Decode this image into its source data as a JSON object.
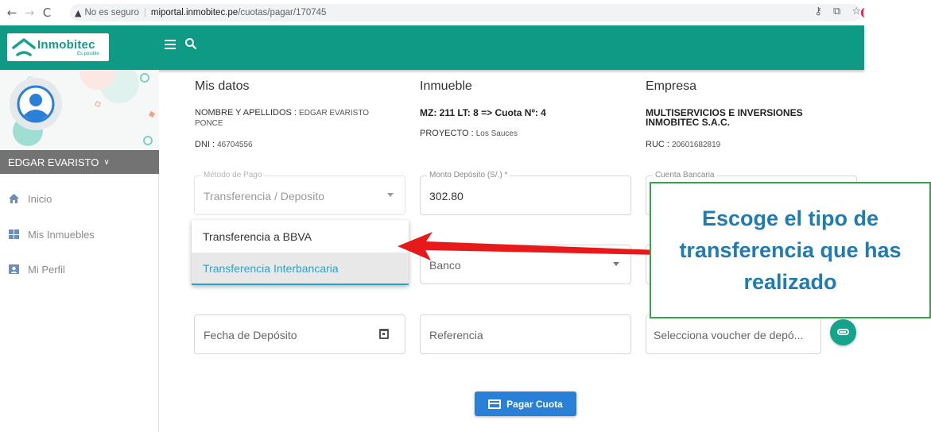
{
  "browser": {
    "security_text": "No es seguro",
    "url_host": "miportal.inmobitec.pe",
    "url_path": "/cuotas/pagar/170745"
  },
  "header": {
    "logo_name": "Inmobitec",
    "logo_tagline": "Es posible",
    "brand_color": "#0f9a85"
  },
  "sidebar": {
    "user_name": "EDGAR EVARISTO",
    "items": [
      {
        "label": "Inicio",
        "icon": "home-icon"
      },
      {
        "label": "Mis Inmuebles",
        "icon": "grid-icon"
      },
      {
        "label": "Mi Perfil",
        "icon": "profile-card-icon"
      }
    ]
  },
  "mis_datos": {
    "title": "Mis datos",
    "name_label": "NOMBRE Y APELLIDOS :",
    "name_value_1": "EDGAR EVARISTO",
    "name_value_2": "PONCE",
    "dni_label": "DNI :",
    "dni_value": "46704556"
  },
  "inmueble": {
    "title": "Inmueble",
    "lote": "MZ: 211 LT: 8 => Cuota Nº: 4",
    "proyecto_label": "PROYECTO :",
    "proyecto_value": "Los Sauces"
  },
  "empresa": {
    "title": "Empresa",
    "name_1": "MULTISERVICIOS E INVERSIONES",
    "name_2": "INMOBITEC S.A.C.",
    "ruc_label": "RUC :",
    "ruc_value": "20601682819"
  },
  "form": {
    "metodo_label": "Método de Pago",
    "metodo_value": "Transferencia / Deposito",
    "monto_label": "Monto Depósito (S/.) *",
    "monto_value": "302.80",
    "cuenta_label": "Cuenta Bancaria",
    "banco_placeholder": "Banco",
    "fecha_placeholder": "Fecha de Depósito",
    "referencia_placeholder": "Referencia",
    "voucher_placeholder": "Selecciona voucher de depó...",
    "dropdown_options": [
      "Transferencia a BBVA",
      "Transferencia Interbancaria"
    ],
    "selected_option": "Transferencia Interbancaria",
    "pay_button": "Pagar Cuota"
  },
  "annotation": {
    "callout_text": "Escoge el tipo de transferencia que has realizado",
    "callout_color": "#1f7bb3",
    "arrow_color": "#e8191b"
  }
}
